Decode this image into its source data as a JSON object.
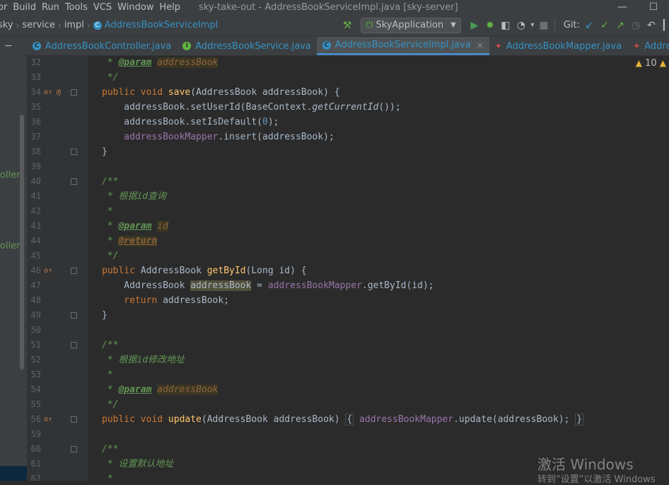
{
  "menu": [
    "or",
    "Build",
    "Run",
    "Tools",
    "VCS",
    "Window",
    "Help"
  ],
  "window_title": "sky-take-out - AddressBookServiceImpl.java [sky-server]",
  "window_controls": [
    "—",
    "☐"
  ],
  "breadcrumb": [
    "sky",
    "service",
    "impl",
    "AddressBookServiceImpl"
  ],
  "breadcrumb_class_icon": "C",
  "run_config": {
    "label": "SkyApplication",
    "icon": "spring-boot-icon"
  },
  "git_label": "Git:",
  "tabs": [
    {
      "label": "AddressBookController.java",
      "icon_letter": "C",
      "icon_color": "#3592c4",
      "active": false
    },
    {
      "label": "AddressBookService.java",
      "icon_letter": "I",
      "icon_color": "#62b543",
      "active": false
    },
    {
      "label": "AddressBookServiceImpl.java",
      "icon_letter": "C",
      "icon_color": "#3592c4",
      "active": true,
      "close": "×"
    },
    {
      "label": "AddressBookMapper.java",
      "icon_letter": "",
      "icon_color": "#cf4a46",
      "active": false
    },
    {
      "label": "Address",
      "icon_letter": "",
      "icon_color": "#cf4a46",
      "active": false
    }
  ],
  "left_strip": {
    "items": [
      "oller",
      "oller"
    ]
  },
  "warnings": {
    "count": "10"
  },
  "code": {
    "l32": {
      "n": "32",
      "star": " * ",
      "tag": "@param",
      "val": "addressBook"
    },
    "l33": {
      "n": "33",
      "t": " */"
    },
    "l34": {
      "n": "34",
      "mark": "o↑ @",
      "kw": "public void ",
      "fn": "save",
      "rest": "(AddressBook addressBook) {"
    },
    "l35": {
      "n": "35",
      "a": "    addressBook.setUserId(BaseContext.",
      "b": "getCurrentId",
      "c": "());"
    },
    "l36": {
      "n": "36",
      "a": "    addressBook.setIsDefault(",
      "num": "0",
      "c": ");"
    },
    "l37": {
      "n": "37",
      "f": "    addressBookMapper",
      "c": ".insert(addressBook);"
    },
    "l38": {
      "n": "38",
      "t": "}"
    },
    "l39": {
      "n": "39"
    },
    "l40": {
      "n": "40",
      "t": "/**"
    },
    "l41": {
      "n": "41",
      "t": " * 根据id查询"
    },
    "l42": {
      "n": "42",
      "t": " *"
    },
    "l43": {
      "n": "43",
      "star": " * ",
      "tag": "@param",
      "val": "id"
    },
    "l44": {
      "n": "44",
      "star": " * ",
      "tag": "@return"
    },
    "l45": {
      "n": "45",
      "t": " */"
    },
    "l46": {
      "n": "46",
      "mark": "o↑",
      "kw": "public ",
      "a": "AddressBook ",
      "fn": "getById",
      "rest": "(Long id) {"
    },
    "l47": {
      "n": "47",
      "a": "    AddressBook ",
      "hl": "addressBook",
      "b": " = ",
      "f": "addressBookMapper",
      "c": ".getById(id);"
    },
    "l48": {
      "n": "48",
      "kw": "    return ",
      "c": "addressBook;"
    },
    "l49": {
      "n": "49",
      "t": "}"
    },
    "l50": {
      "n": "50"
    },
    "l51": {
      "n": "51",
      "t": "/**"
    },
    "l52": {
      "n": "52",
      "t": " * 根据id修改地址"
    },
    "l53": {
      "n": "53",
      "t": " *"
    },
    "l54": {
      "n": "54",
      "star": " * ",
      "tag": "@param",
      "val": "addressBook"
    },
    "l55": {
      "n": "55",
      "t": " */"
    },
    "l56": {
      "n": "56",
      "mark": "o↑",
      "kw": "public void ",
      "fn": "update",
      "a": "(AddressBook addressBook) ",
      "b1": "{",
      "f": " addressBookMapper",
      "c": ".update(addressBook);",
      "b2": "}"
    },
    "l59": {
      "n": "59"
    },
    "l60": {
      "n": "60",
      "t": "/**"
    },
    "l61": {
      "n": "61",
      "t": " * 设置默认地址"
    },
    "l62": {
      "n": "62",
      "t": " *"
    }
  },
  "watermark": {
    "line1": "激活 Windows",
    "line2": "转到“设置”以激活 Windows"
  }
}
